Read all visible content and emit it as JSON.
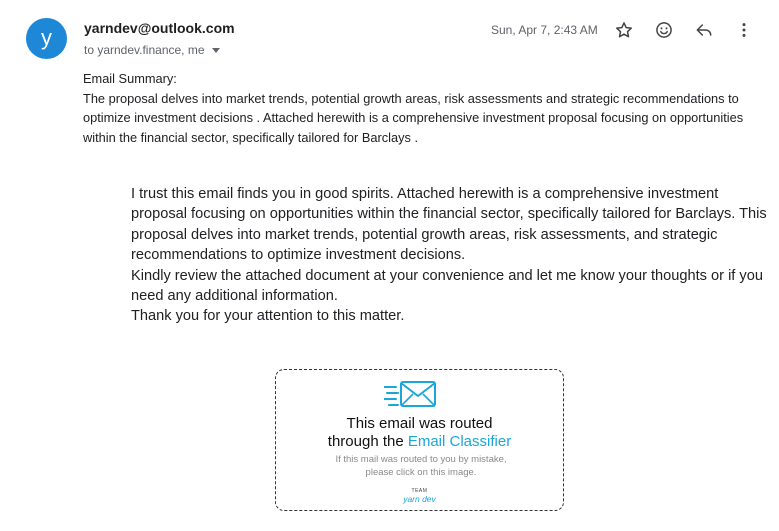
{
  "email": {
    "avatar_letter": "y",
    "sender": "yarndev@outlook.com",
    "recipients": "to yarndev.finance, me",
    "datetime": "Sun, Apr 7, 2:43 AM",
    "actions": {
      "star": "star-icon",
      "react": "emoji-icon",
      "reply": "reply-icon",
      "more": "more-vert-icon"
    }
  },
  "summary": {
    "heading": "Email Summary:",
    "text": " The proposal delves into market trends, potential growth areas, risk assessments and strategic recommendations to optimize investment decisions . Attached herewith is a comprehensive investment proposal focusing on opportunities within the financial sector, specifically tailored for Barclays ."
  },
  "body": {
    "paragraph_1": "I trust this email finds you in good spirits. Attached herewith is a comprehensive investment proposal focusing on opportunities within the financial sector, specifically tailored for Barclays. This proposal delves into market trends, potential growth areas, risk assessments, and strategic recommendations to optimize investment decisions.",
    "paragraph_2": "Kindly review the attached document at your convenience and let me know your thoughts or if you need any additional information.",
    "paragraph_3": "Thank you for your attention to this matter."
  },
  "banner": {
    "title_line1": "This email was routed",
    "title_line2_prefix": "through the ",
    "title_line2_accent": "Email Classifier",
    "subtitle": "If this mail was routed to you by mistake, please click on this image.",
    "team_label": "TEAM",
    "brand": "yarn dev",
    "accent_color": "#1aa7d8"
  },
  "colors": {
    "avatar_bg": "#1e88d6",
    "muted_text": "#5f6368"
  }
}
